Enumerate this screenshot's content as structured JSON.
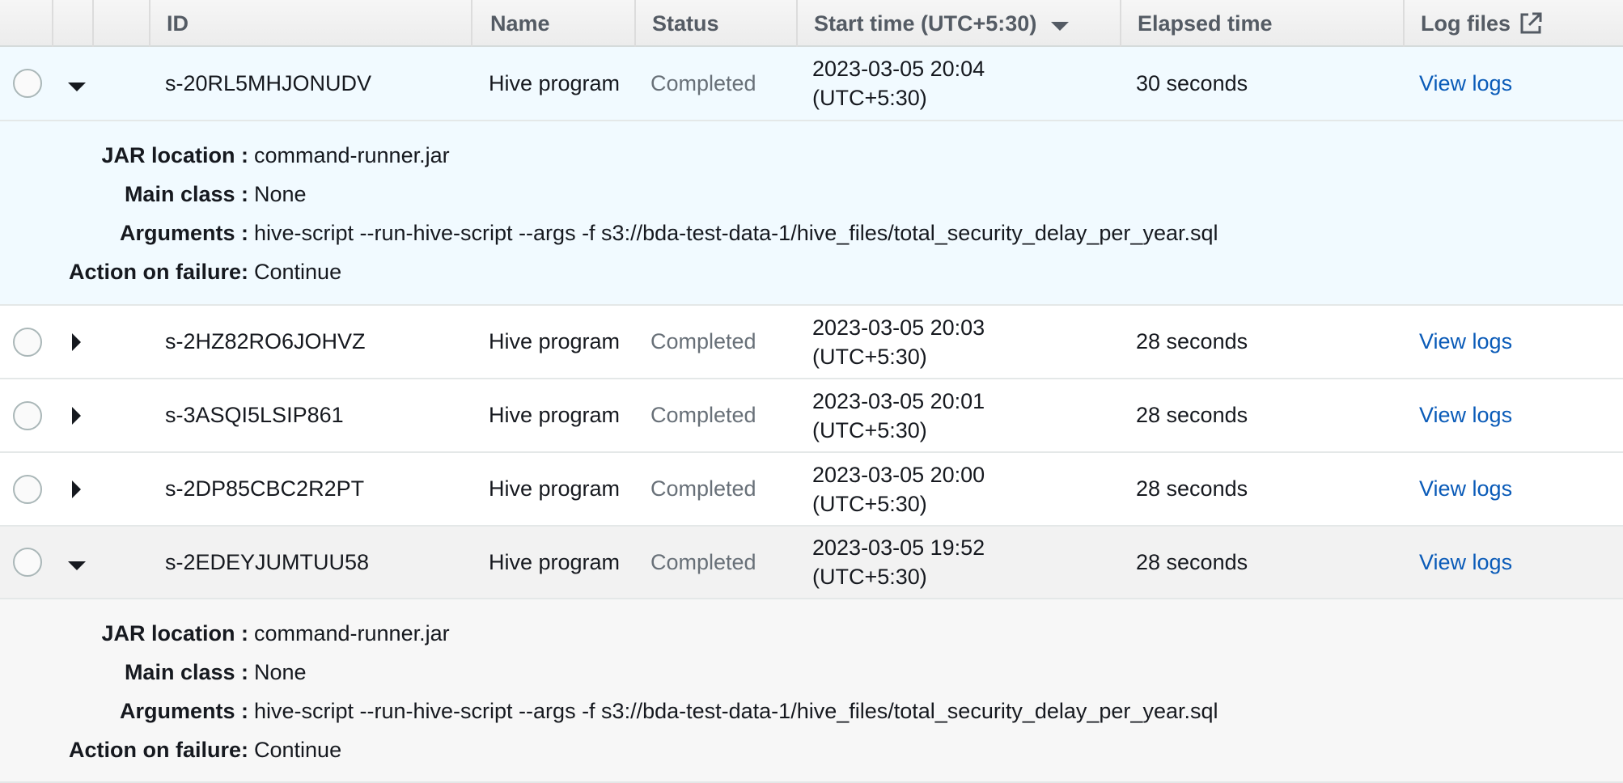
{
  "header": {
    "id": "ID",
    "name": "Name",
    "status": "Status",
    "start_time": "Start time (UTC+5:30)",
    "elapsed": "Elapsed time",
    "log_files": "Log files"
  },
  "rows": [
    {
      "id": "s-20RL5MHJONUDV",
      "name": "Hive program",
      "status": "Completed",
      "start_date": "2023-03-05 20:04",
      "start_tz": "(UTC+5:30)",
      "elapsed": "30 seconds",
      "log_link": "View logs",
      "expanded": true,
      "details": {
        "jar_label": "JAR location :",
        "jar_value": "command-runner.jar",
        "main_label": "Main class :",
        "main_value": "None",
        "args_label": "Arguments :",
        "args_value": "hive-script --run-hive-script --args -f s3://bda-test-data-1/hive_files/total_security_delay_per_year.sql",
        "fail_label": "Action on failure:",
        "fail_value": "Continue"
      }
    },
    {
      "id": "s-2HZ82RO6JOHVZ",
      "name": "Hive program",
      "status": "Completed",
      "start_date": "2023-03-05 20:03",
      "start_tz": "(UTC+5:30)",
      "elapsed": "28 seconds",
      "log_link": "View logs",
      "expanded": false
    },
    {
      "id": "s-3ASQI5LSIP861",
      "name": "Hive program",
      "status": "Completed",
      "start_date": "2023-03-05 20:01",
      "start_tz": "(UTC+5:30)",
      "elapsed": "28 seconds",
      "log_link": "View logs",
      "expanded": false
    },
    {
      "id": "s-2DP85CBC2R2PT",
      "name": "Hive program",
      "status": "Completed",
      "start_date": "2023-03-05 20:00",
      "start_tz": "(UTC+5:30)",
      "elapsed": "28 seconds",
      "log_link": "View logs",
      "expanded": false
    },
    {
      "id": "s-2EDEYJUMTUU58",
      "name": "Hive program",
      "status": "Completed",
      "start_date": "2023-03-05 19:52",
      "start_tz": "(UTC+5:30)",
      "elapsed": "28 seconds",
      "log_link": "View logs",
      "expanded": true,
      "details": {
        "jar_label": "JAR location :",
        "jar_value": "command-runner.jar",
        "main_label": "Main class :",
        "main_value": "None",
        "args_label": "Arguments :",
        "args_value": "hive-script --run-hive-script --args -f s3://bda-test-data-1/hive_files/total_security_delay_per_year.sql",
        "fail_label": "Action on failure:",
        "fail_value": "Continue"
      }
    }
  ],
  "icons": {
    "sort": "sort-descending-icon",
    "external": "external-link-icon",
    "expand": "caret-icon"
  },
  "colors": {
    "link": "#0a5bb8",
    "status": "#687078",
    "selected_row": "#f1faff",
    "hover_row": "#f2f2f2"
  }
}
